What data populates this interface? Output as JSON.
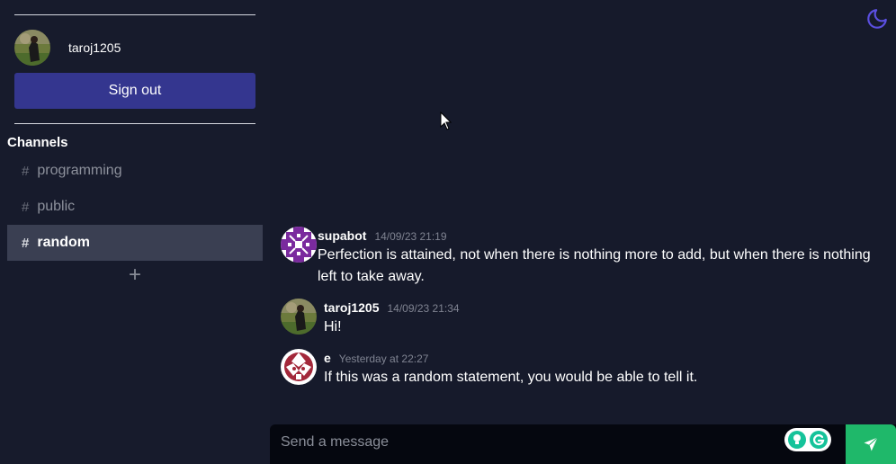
{
  "user": {
    "name": "taroj1205"
  },
  "sidebar": {
    "signout_label": "Sign out",
    "channels_title": "Channels",
    "hash": "#",
    "add_icon": "+",
    "channels": [
      {
        "name": "programming",
        "active": false
      },
      {
        "name": "public",
        "active": false
      },
      {
        "name": "random",
        "active": true
      }
    ]
  },
  "messages": [
    {
      "author": "supabot",
      "time": "14/09/23 21:19",
      "text": "Perfection is attained, not when there is nothing more to add, but when there is nothing left to take away.",
      "avatar": "pattern-purple"
    },
    {
      "author": "taroj1205",
      "time": "14/09/23 21:34",
      "text": "Hi!",
      "avatar": "photo"
    },
    {
      "author": "e",
      "time": "Yesterday at 22:27",
      "text": "If this was a random statement, you would be able to tell it.",
      "avatar": "pattern-red"
    }
  ],
  "composer": {
    "placeholder": "Send a message"
  },
  "icons": {
    "theme": "moon-icon",
    "send": "paper-plane-icon",
    "add": "plus-icon"
  },
  "colors": {
    "accent": "#34368f",
    "send": "#1fb86a",
    "theme_icon": "#5b4fe0"
  }
}
